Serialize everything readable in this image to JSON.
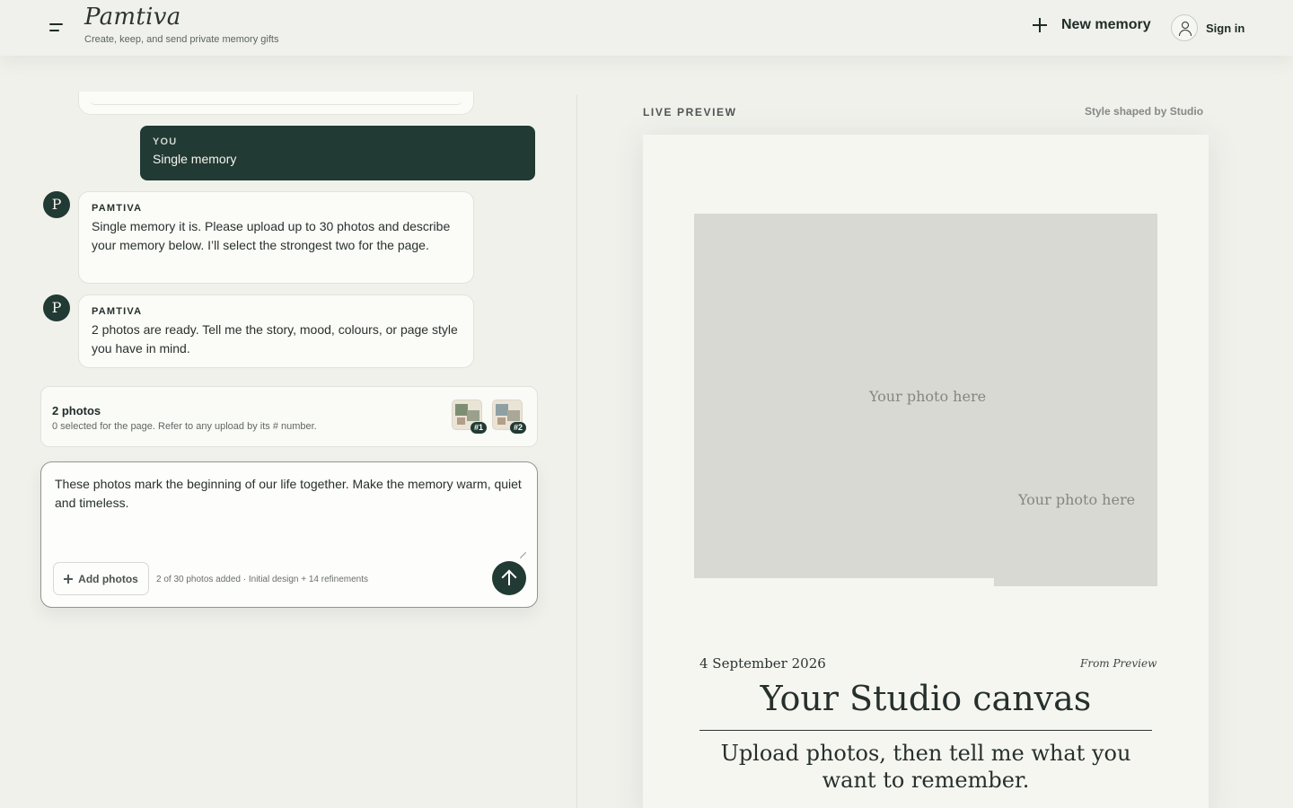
{
  "header": {
    "logo": "Pamtiva",
    "tagline": "Create, keep, and send private memory gifts",
    "new_memory": "New memory",
    "sign_in": "Sign in",
    "icons": {
      "menu": "menu-icon",
      "plus": "plus-icon",
      "account": "user-icon"
    }
  },
  "chat": {
    "messages": [
      {
        "role": "user",
        "tag": "YOU",
        "text": "Single memory"
      },
      {
        "role": "assistant",
        "avatar": "P",
        "tag": "PAMTIVA",
        "text": "Single memory it is. Please upload up to 30 photos and describe your memory below. I’ll select the strongest two for the page."
      },
      {
        "role": "assistant",
        "avatar": "P",
        "tag": "PAMTIVA",
        "text": "2 photos are ready. Tell me the story, mood, colours, or page style you have in mind."
      }
    ],
    "photos": {
      "count_label": "2 photos",
      "hint": "0 selected for the page. Refer to any upload by its # number.",
      "thumbs": [
        {
          "badge": "#1"
        },
        {
          "badge": "#2"
        }
      ]
    },
    "composer": {
      "value": "These photos mark the beginning of our life together. Make the memory warm, quiet and timeless.",
      "add_photos": "Add photos",
      "meta": "2 of 30 photos added · Initial design + 14 refinements"
    }
  },
  "preview": {
    "label": "LIVE PREVIEW",
    "note": "Style shaped by Studio",
    "photo_placeholder_1": "Your photo here",
    "photo_placeholder_2": "Your photo here",
    "date": "4 September 2026",
    "from": "From Preview",
    "title": "Your Studio canvas",
    "subtitle": "Upload photos, then tell me what you want to remember."
  },
  "colors": {
    "accent": "#213a33",
    "background": "#f1f1ec",
    "card": "#f6f6f1",
    "placeholder": "#d9d9d3"
  }
}
